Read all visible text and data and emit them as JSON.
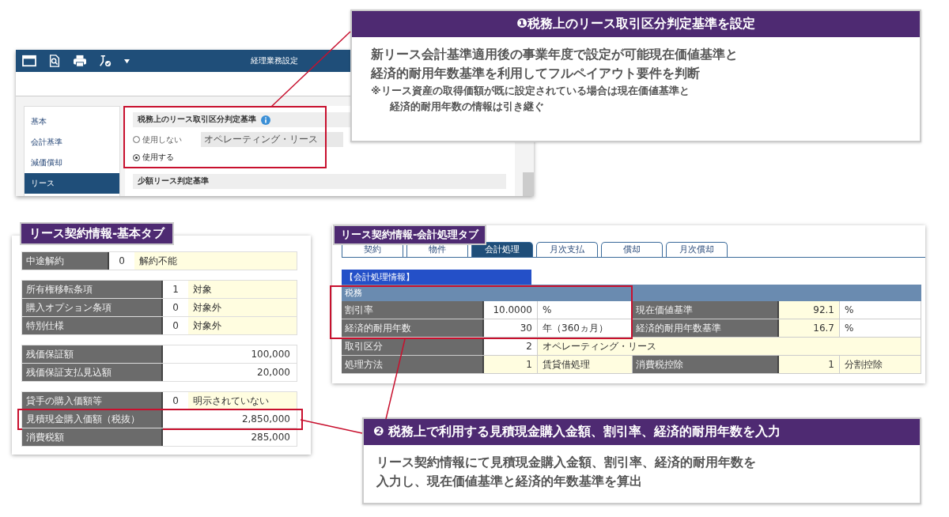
{
  "settings_window": {
    "title": "経理業務設定",
    "sidebar": [
      {
        "label": "基本",
        "selected": false
      },
      {
        "label": "会計基準",
        "selected": false
      },
      {
        "label": "減価償却",
        "selected": false
      },
      {
        "label": "リース",
        "selected": true
      }
    ],
    "section_title": "税務上のリース取引区分判定基準",
    "options": [
      {
        "label": "使用しない",
        "selected": false
      },
      {
        "label": "使用する",
        "selected": true
      }
    ],
    "select_value": "オペレーティング・リース",
    "section2_title": "少額リース判定基準"
  },
  "callout_1": {
    "number": "❶",
    "title": "税務上のリース取引区分判定基準を設定",
    "lines": [
      "新リース会計基準適用後の事業年度で設定が可能現在価値基準と",
      "経済的耐用年数基準を利用してフルペイアウト要件を判断"
    ],
    "notes": [
      "※リース資産の取得価額が既に設定されている場合は現在価値基準と",
      "経済的耐用年数の情報は引き継ぐ"
    ]
  },
  "basic_tab": {
    "title": "リース契約情報-基本タブ",
    "groups": [
      {
        "rows": [
          {
            "kind": "coded",
            "label": "中途解約",
            "code": "0",
            "value": "解約不能"
          }
        ]
      },
      {
        "rows": [
          {
            "kind": "coded",
            "label": "所有権移転条項",
            "code": "1",
            "value": "対象"
          },
          {
            "kind": "coded",
            "label": "購入オプション条項",
            "code": "0",
            "value": "対象外"
          },
          {
            "kind": "coded",
            "label": "特別仕様",
            "code": "0",
            "value": "対象外"
          }
        ]
      },
      {
        "rows": [
          {
            "kind": "amount",
            "label": "残価保証額",
            "amount": "100,000"
          },
          {
            "kind": "amount",
            "label": "残価保証支払見込額",
            "amount": "20,000"
          }
        ]
      },
      {
        "rows": [
          {
            "kind": "coded",
            "label": "貸手の購入価額等",
            "code": "0",
            "value": "明示されていない"
          },
          {
            "kind": "amount",
            "label": "見積現金購入価額（税抜）",
            "amount": "2,850,000",
            "highlighted": true
          },
          {
            "kind": "amount",
            "label": "消費税額",
            "amount": "285,000"
          }
        ]
      }
    ]
  },
  "accounting_tab": {
    "title": "リース契約情報-会計処理タブ",
    "tabs": [
      {
        "label": "契約",
        "selected": false
      },
      {
        "label": "物件",
        "selected": false
      },
      {
        "label": "会計処理",
        "selected": true
      },
      {
        "label": "月次支払",
        "selected": false
      },
      {
        "label": "償却",
        "selected": false
      },
      {
        "label": "月次償却",
        "selected": false
      }
    ],
    "section": "【会計処理情報】",
    "subsection": "税務",
    "rows": [
      {
        "kind": "pair",
        "label": "割引率",
        "value": "10.0000",
        "unit": "%",
        "label2": "現在価値基準",
        "value2": "92.1",
        "unit2": "%"
      },
      {
        "kind": "pair",
        "label": "経済的耐用年数",
        "value": "30",
        "unit": "年（360ヵ月）",
        "label2": "経済的耐用年数基準",
        "value2": "16.7",
        "unit2": "%"
      },
      {
        "kind": "single",
        "label": "取引区分",
        "code": "2",
        "value": "オペレーティング・リース"
      },
      {
        "kind": "pair_coded",
        "label": "処理方法",
        "value": "1",
        "unit": "賃貸借処理",
        "label2": "消費税控除",
        "value2": "1",
        "unit2": "分割控除"
      }
    ]
  },
  "callout_2": {
    "number": "❷",
    "title": "税務上で利用する見積現金購入金額、割引率、経済的耐用年数を入力",
    "lines": [
      "リース契約情報にて見積現金購入金額、割引率、経済的耐用年数を",
      "入力し、現在価値基準と経済的年数基準を算出"
    ]
  }
}
